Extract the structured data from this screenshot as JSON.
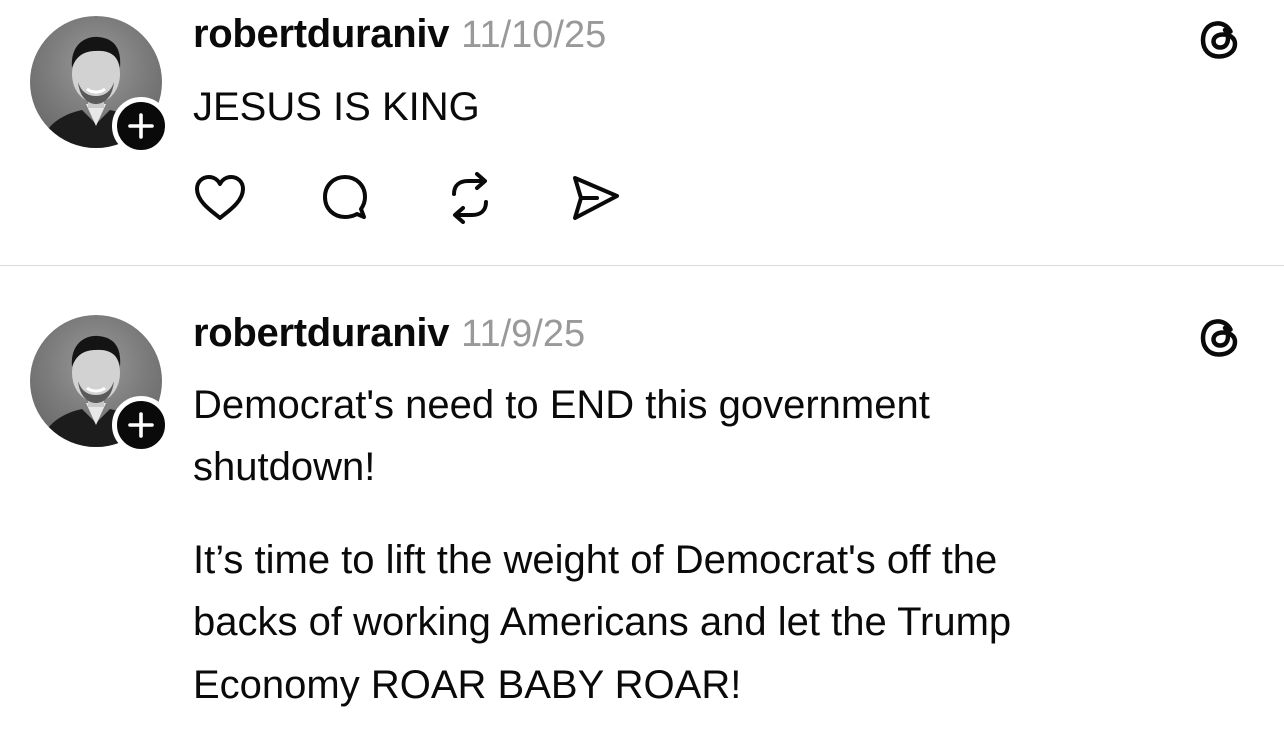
{
  "posts": [
    {
      "username": "robertduraniv",
      "timestamp": "11/10/25",
      "text_lines": [
        "JESUS IS KING"
      ],
      "avatar_icon": "profile-photo",
      "follow_icon": "plus-icon",
      "logo_icon": "threads-logo-icon",
      "actions": [
        "heart-icon",
        "comment-icon",
        "repost-icon",
        "share-icon"
      ]
    },
    {
      "username": "robertduraniv",
      "timestamp": "11/9/25",
      "text_lines": [
        "Democrat's need to END this government",
        "shutdown!",
        "It’s time to lift the weight of Democrat's off the",
        "backs of working Americans and let the Trump",
        "Economy ROAR BABY ROAR!"
      ],
      "avatar_icon": "profile-photo",
      "follow_icon": "plus-icon",
      "logo_icon": "threads-logo-icon"
    }
  ],
  "colors": {
    "text": "#0a0a0a",
    "timestamp": "#999999",
    "divider": "#d9d9d9",
    "background": "#ffffff"
  }
}
